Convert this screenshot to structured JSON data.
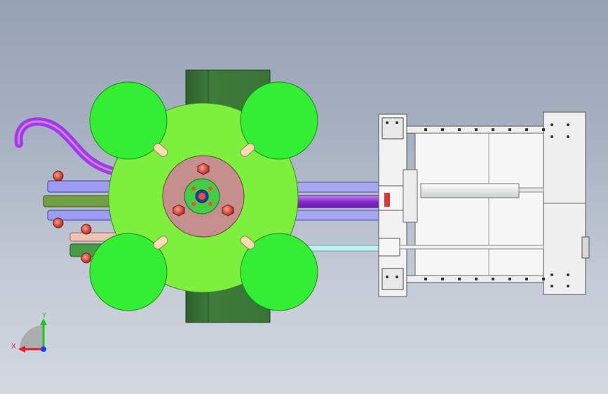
{
  "viewport": {
    "background_top": "#97a2b5",
    "background_bottom": "#d3d8e1"
  },
  "colors": {
    "lobe_green": "#33ee33",
    "disc_green": "#7cf03c",
    "dark_green_block": "#3d7c3a",
    "hub_pink": "#c48f8d",
    "center_green": "#44cc44",
    "bolt_red": "#d8483e",
    "frame_white": "#f2f2f2",
    "rail_blue": "#a7a6f0",
    "purple_arm": "#9533d9",
    "cyan_rod": "#bff2f2",
    "hose_purple": "#a23be6",
    "pad_peach": "#f8dcb5"
  },
  "triad": {
    "x_label": "X",
    "y_label": "Y",
    "x_color": "#e02020",
    "y_color": "#20c020",
    "z_color": "#2040ff"
  }
}
